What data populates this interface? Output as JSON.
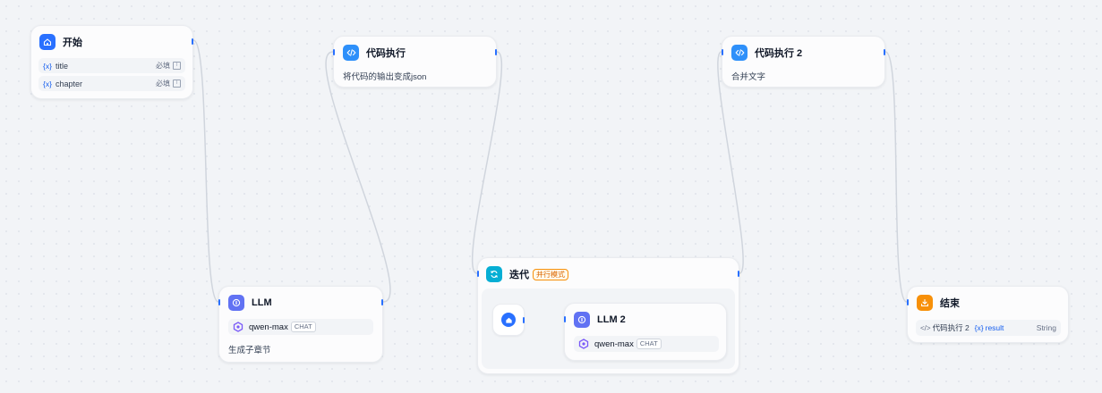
{
  "nodes": {
    "start": {
      "title": "开始",
      "variables": [
        {
          "prefix": "{x}",
          "name": "title",
          "required": "必填"
        },
        {
          "prefix": "{x}",
          "name": "chapter",
          "required": "必填"
        }
      ]
    },
    "code1": {
      "title": "代码执行",
      "description": "将代码的输出变成json"
    },
    "code2": {
      "title": "代码执行 2",
      "description": "合并文字"
    },
    "llm": {
      "title": "LLM",
      "model": "qwen-max",
      "mode": "CHAT",
      "description": "生成子章节"
    },
    "iteration": {
      "title": "迭代",
      "mode_badge": "并行模式"
    },
    "llm2": {
      "title": "LLM 2",
      "model": "qwen-max",
      "mode": "CHAT"
    },
    "end": {
      "title": "结束",
      "output": {
        "source": "代码执行 2",
        "prefix": "{x}",
        "name": "result",
        "type": "String"
      }
    }
  },
  "colors": {
    "start_icon": "#2970ff",
    "code_icon": "#2e90fa",
    "llm_icon": "#6172f3",
    "iteration_icon": "#06aed4",
    "end_icon": "#f79009",
    "handle": "#2970ff",
    "edge": "#d0d5dd"
  }
}
